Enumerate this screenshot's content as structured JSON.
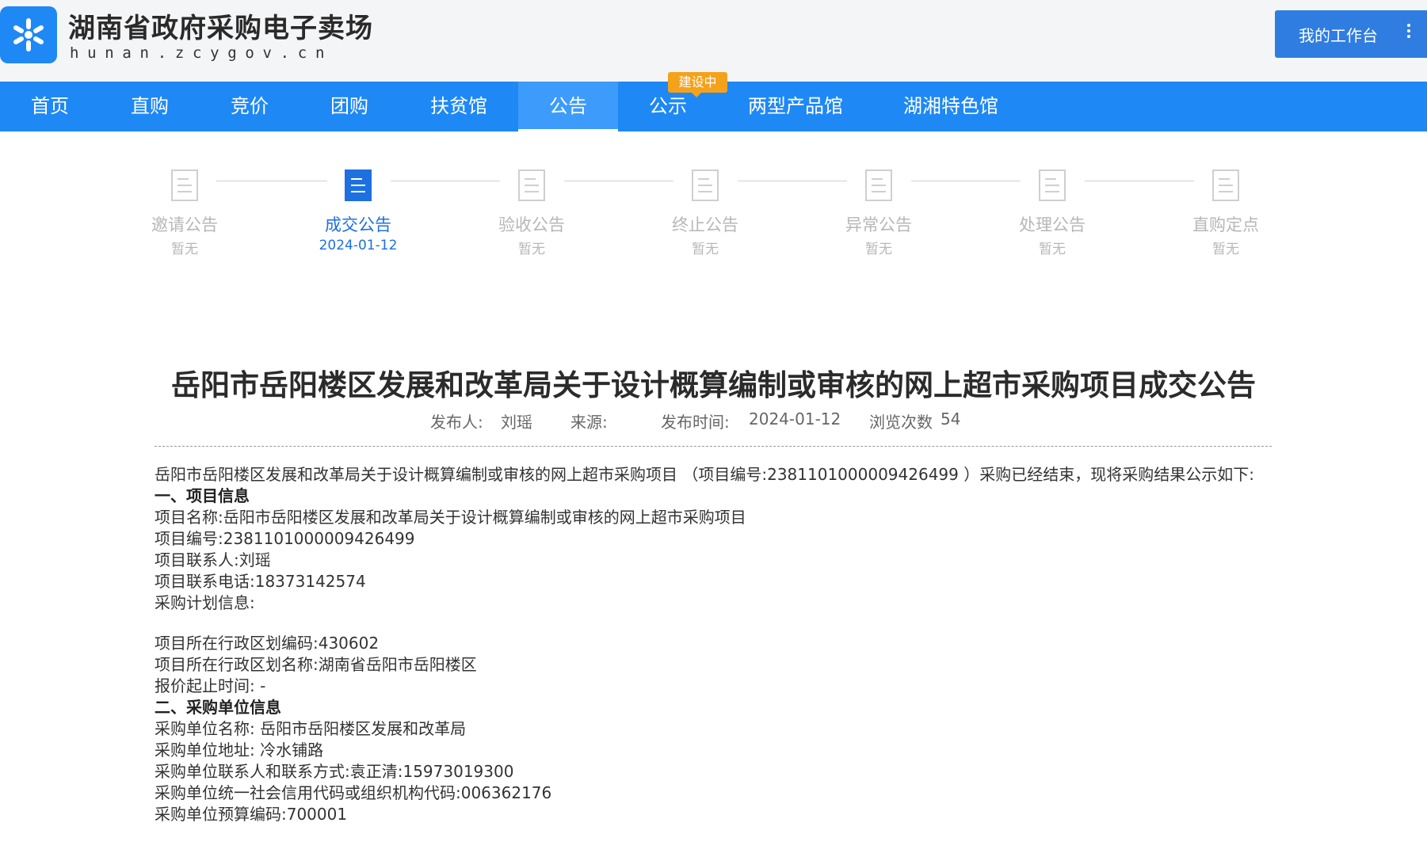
{
  "header": {
    "site_name": "湖南省政府采购电子卖场",
    "domain": "hunan.zcygov.cn",
    "workbench_label": "我的工作台",
    "logo_icon": "asterisk-logo-icon",
    "menu_icon": "vertical-dots-icon"
  },
  "nav": {
    "items": [
      "首页",
      "直购",
      "竞价",
      "团购",
      "扶贫馆",
      "公告",
      "公示",
      "两型产品馆",
      "湖湘特色馆"
    ],
    "active": "公告",
    "badge": "建设中",
    "colors": {
      "bar": "#1e88f5",
      "badge": "#f5a21b"
    }
  },
  "steps": [
    {
      "title": "邀请公告",
      "sub": "暂无"
    },
    {
      "title": "成交公告",
      "sub": "2024-01-12"
    },
    {
      "title": "验收公告",
      "sub": "暂无"
    },
    {
      "title": "终止公告",
      "sub": "暂无"
    },
    {
      "title": "异常公告",
      "sub": "暂无"
    },
    {
      "title": "处理公告",
      "sub": "暂无"
    },
    {
      "title": "直购定点",
      "sub": "暂无"
    }
  ],
  "article": {
    "title": "岳阳市岳阳楼区发展和改革局关于设计概算编制或审核的网上超市采购项目成交公告",
    "meta": {
      "publisher_label": "发布人:",
      "publisher": "刘瑶",
      "source_label": "来源:",
      "time_label": "发布时间:",
      "time": "2024-01-12",
      "views_label": "浏览次数",
      "views": "54"
    },
    "intro": "岳阳市岳阳楼区发展和改革局关于设计概算编制或审核的网上超市采购项目 （项目编号:2381101000009426499 ）采购已经结束，现将采购结果公示如下:",
    "section1": {
      "heading": "一、项目信息",
      "lines": [
        "项目名称:岳阳市岳阳楼区发展和改革局关于设计概算编制或审核的网上超市采购项目",
        "项目编号:2381101000009426499",
        "项目联系人:刘瑶",
        "项目联系电话:18373142574",
        "采购计划信息:"
      ],
      "lines2": [
        "项目所在行政区划编码:430602",
        "项目所在行政区划名称:湖南省岳阳市岳阳楼区",
        "报价起止时间: -"
      ]
    },
    "section2": {
      "heading": "二、采购单位信息",
      "lines": [
        "采购单位名称: 岳阳市岳阳楼区发展和改革局",
        "采购单位地址: 冷水铺路",
        "采购单位联系人和联系方式:袁正清:15973019300",
        "采购单位统一社会信用代码或组织机构代码:006362176",
        "采购单位预算编码:700001"
      ]
    }
  }
}
